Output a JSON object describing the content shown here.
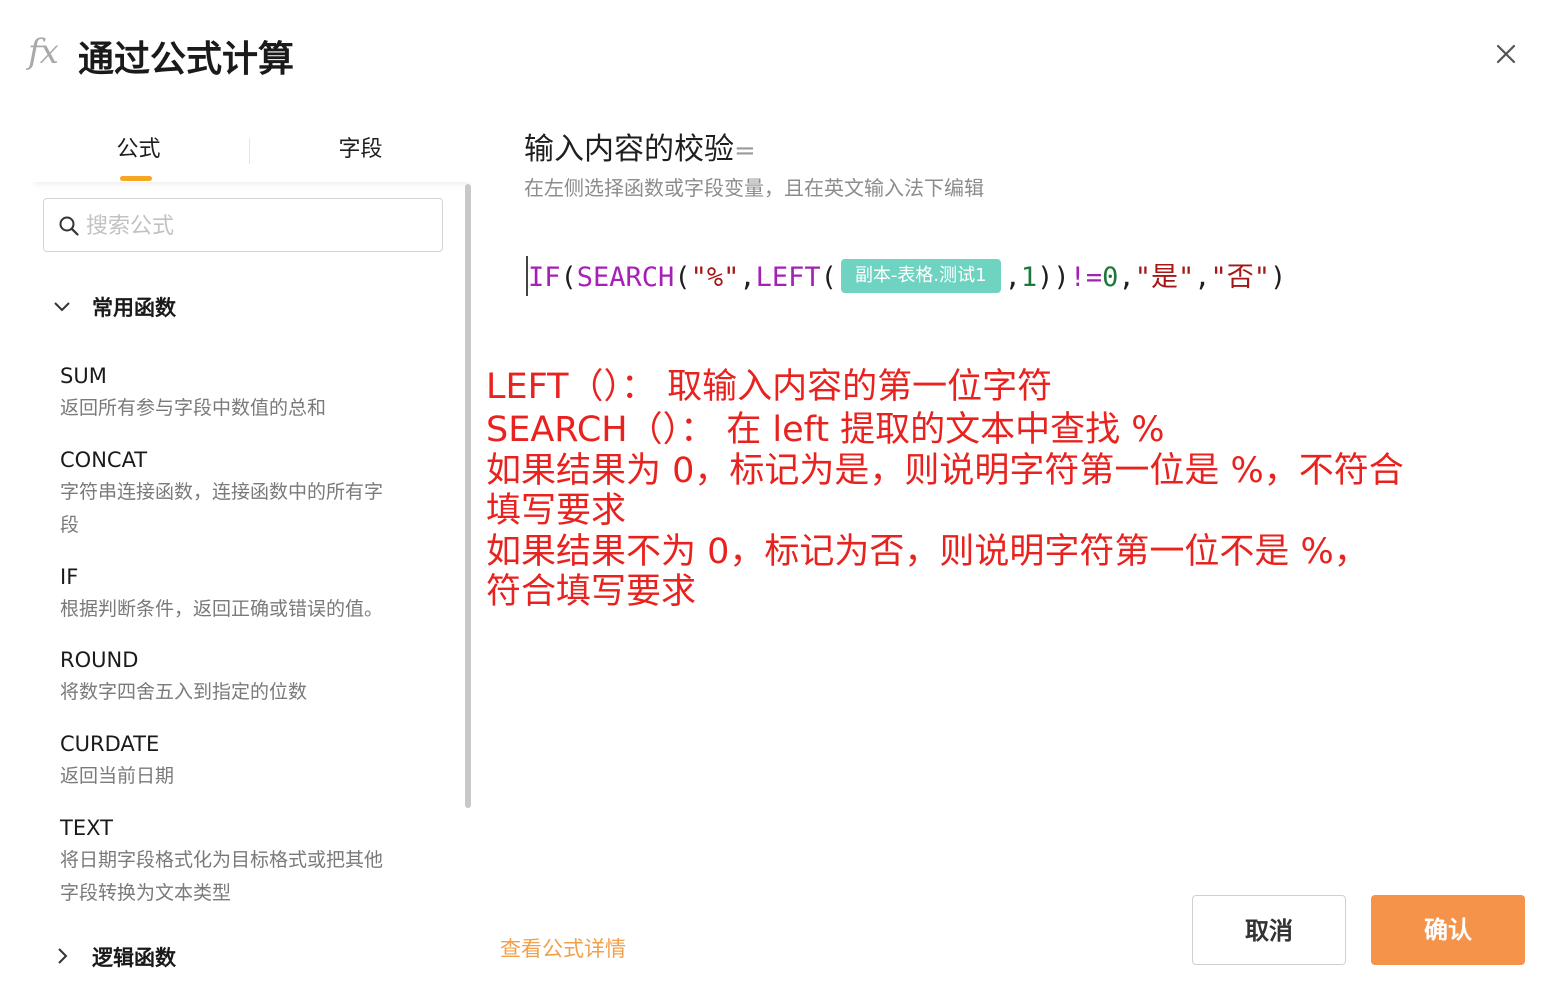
{
  "dialog": {
    "icon_text": "fx",
    "title": "通过公式计算",
    "close_icon": "close-icon"
  },
  "tabs": [
    {
      "label": "公式",
      "active": true
    },
    {
      "label": "字段",
      "active": false
    }
  ],
  "search": {
    "placeholder": "搜索公式",
    "value": ""
  },
  "groups": [
    {
      "label": "常用函数",
      "expanded": true,
      "functions": [
        {
          "name": "SUM",
          "desc_lines": [
            "返回所有参与字段中数值的总和"
          ]
        },
        {
          "name": "CONCAT",
          "desc_lines": [
            "字符串连接函数，连接函数中的所有字",
            "段"
          ]
        },
        {
          "name": "IF",
          "desc_lines": [
            "根据判断条件，返回正确或错误的值。"
          ]
        },
        {
          "name": "ROUND",
          "desc_lines": [
            "将数字四舍五入到指定的位数"
          ]
        },
        {
          "name": "CURDATE",
          "desc_lines": [
            "返回当前日期"
          ]
        },
        {
          "name": "TEXT",
          "desc_lines": [
            "将日期字段格式化为目标格式或把其他",
            "字段转换为文本类型"
          ]
        }
      ]
    },
    {
      "label": "逻辑函数",
      "expanded": false
    }
  ],
  "editor": {
    "field_label": "输入内容的校验",
    "equals": "=",
    "hint": "在左侧选择函数或字段变量，且在英文输入法下编辑",
    "formula_tokens": {
      "t1": "IF",
      "t2": "(",
      "t3": "SEARCH",
      "t4": "(",
      "t5": "\"%\"",
      "t6": ",",
      "t7": "LEFT",
      "t8": "(",
      "chip": "副本-表格.测试1",
      "t9": ",",
      "t10": "1",
      "t11": "))",
      "t12": "!=",
      "t13": "0",
      "t14": ",",
      "t15": "\"是\"",
      "t16": ",",
      "t17": "\"否\"",
      "t18": ")"
    }
  },
  "annotation": {
    "color": "#e8231f",
    "lines": [
      "LEFT（）：  取输入内容的第一位字符",
      "SEARCH（）：  在 left 提取的文本中查找 %",
      "如果结果为 0，标记为是，则说明字符第一位是 %，不符合",
      "填写要求",
      "如果结果不为 0，标记为否，则说明字符第一位不是 %，",
      "符合填写要求"
    ]
  },
  "footer": {
    "detail_link": "查看公式详情",
    "cancel_label": "取消",
    "confirm_label": "确认"
  },
  "colors": {
    "accent": "#f5934a",
    "tab_indicator": "#f5a623",
    "function_token": "#a61fb6",
    "string_token": "#a51717",
    "number_token": "#1b7a3a",
    "field_chip": "#6fd3c1",
    "link": "#f0a04b"
  }
}
